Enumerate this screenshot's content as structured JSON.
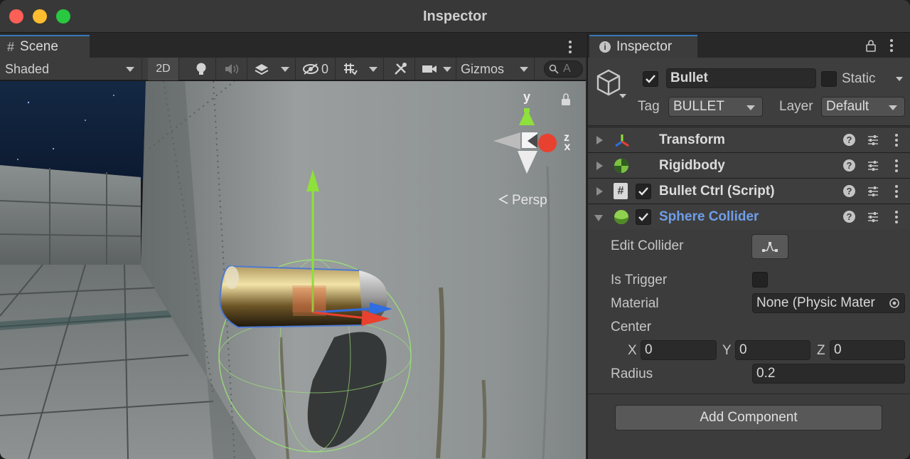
{
  "window": {
    "title": "Inspector"
  },
  "scene": {
    "tab_label": "Scene",
    "toolbar": {
      "shading_mode": "Shaded",
      "mode_2d": "2D",
      "hidden_count": "0",
      "gizmos": "Gizmos",
      "search_placeholder": "A"
    },
    "gizmo": {
      "y_label": "y",
      "z_label": "z",
      "x_label": "x",
      "projection": "Persp"
    }
  },
  "inspector": {
    "tab_label": "Inspector",
    "object": {
      "name": "Bullet",
      "active": true,
      "static_label": "Static",
      "static": false,
      "tag_label": "Tag",
      "tag": "BULLET",
      "layer_label": "Layer",
      "layer": "Default"
    },
    "components": [
      {
        "name": "Transform",
        "icon": "transform-icon",
        "has_toggle": false,
        "expanded": false
      },
      {
        "name": "Rigidbody",
        "icon": "rigidbody-icon",
        "has_toggle": false,
        "expanded": false
      },
      {
        "name": "Bullet Ctrl (Script)",
        "icon": "script-icon",
        "has_toggle": true,
        "enabled": true,
        "expanded": false
      },
      {
        "name": "Sphere Collider",
        "icon": "sphere-collider-icon",
        "has_toggle": true,
        "enabled": true,
        "expanded": true
      }
    ],
    "sphere_collider": {
      "edit_collider_label": "Edit Collider",
      "is_trigger_label": "Is Trigger",
      "is_trigger": false,
      "material_label": "Material",
      "material_value": "None (Physic Mater",
      "center_label": "Center",
      "center": {
        "x_label": "X",
        "x": "0",
        "y_label": "Y",
        "y": "0",
        "z_label": "Z",
        "z": "0"
      },
      "radius_label": "Radius",
      "radius": "0.2"
    },
    "add_component_label": "Add Component"
  },
  "colors": {
    "accent_tab": "#3a79bb",
    "selected_component": "#6f9ee8",
    "gizmo_x": "#e8412f",
    "gizmo_y": "#8ee03a",
    "gizmo_z": "#2f6de0"
  }
}
